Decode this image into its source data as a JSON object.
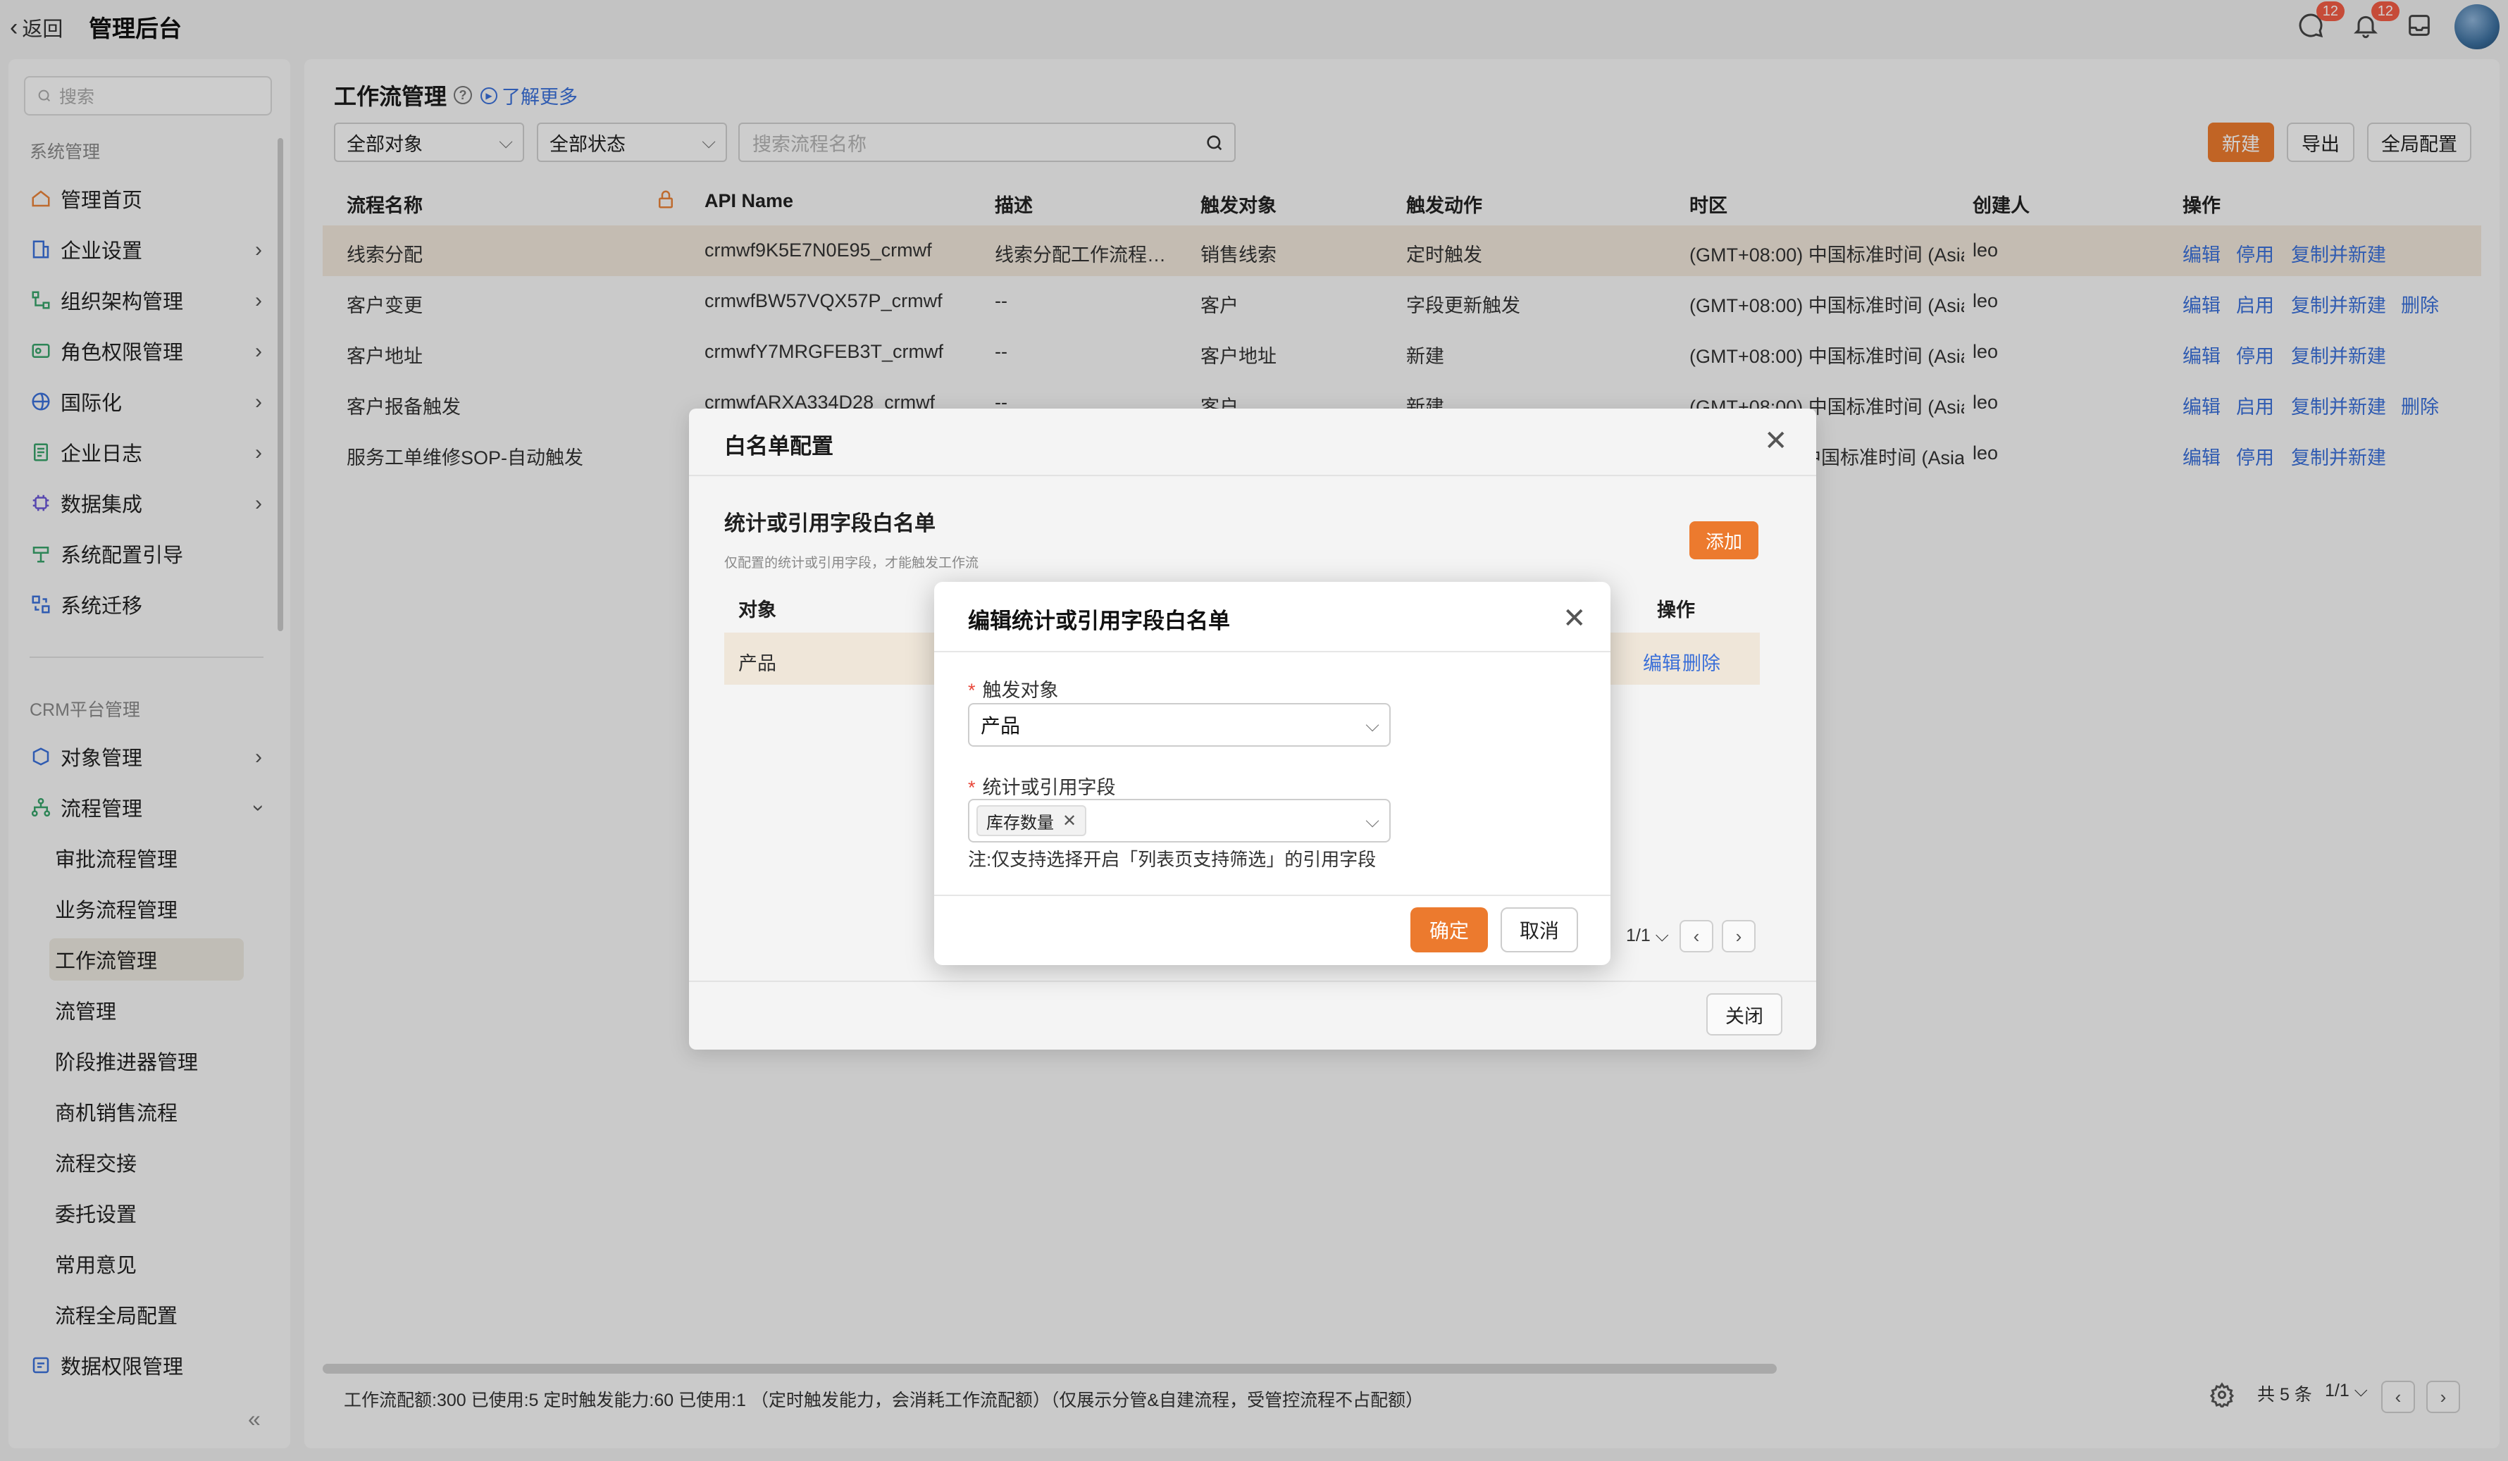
{
  "topbar": {
    "back_label": "返回",
    "app_title": "管理后台",
    "chat_badge": "12",
    "bell_badge": "12"
  },
  "sidebar": {
    "search_placeholder": "搜索",
    "section_system": "系统管理",
    "section_crm": "CRM平台管理",
    "system_items": [
      {
        "label": "管理首页",
        "icon": "home-icon"
      },
      {
        "label": "企业设置",
        "icon": "building-icon"
      },
      {
        "label": "组织架构管理",
        "icon": "org-chart-icon"
      },
      {
        "label": "角色权限管理",
        "icon": "role-icon"
      },
      {
        "label": "国际化",
        "icon": "globe-icon"
      },
      {
        "label": "企业日志",
        "icon": "log-icon"
      },
      {
        "label": "数据集成",
        "icon": "chip-icon"
      },
      {
        "label": "系统配置引导",
        "icon": "guide-icon"
      },
      {
        "label": "系统迁移",
        "icon": "migrate-icon"
      }
    ],
    "crm_items": [
      {
        "label": "对象管理",
        "icon": "object-icon"
      },
      {
        "label": "流程管理",
        "icon": "flow-icon"
      }
    ],
    "flow_sub_items": [
      "审批流程管理",
      "业务流程管理",
      "工作流管理",
      "流管理",
      "阶段推进器管理",
      "商机销售流程",
      "流程交接",
      "委托设置",
      "常用意见",
      "流程全局配置"
    ],
    "data_perm": "数据权限管理"
  },
  "main": {
    "title": "工作流管理",
    "learn_more": "了解更多",
    "filter_object": "全部对象",
    "filter_status": "全部状态",
    "search_placeholder": "搜索流程名称",
    "btn_new": "新建",
    "btn_export": "导出",
    "btn_global": "全局配置",
    "columns": [
      "流程名称",
      "API Name",
      "描述",
      "触发对象",
      "触发动作",
      "时区",
      "创建人",
      "操作"
    ],
    "rows": [
      {
        "name": "线索分配",
        "api": "crmwf9K5E7N0E95_crmwf",
        "desc": "线索分配工作流程…",
        "obj": "销售线索",
        "action": "定时触发",
        "tz": "(GMT+08:00) 中国标准时间 (Asia",
        "creator": "leo",
        "ops": [
          "编辑",
          "停用",
          "复制并新建"
        ]
      },
      {
        "name": "客户变更",
        "api": "crmwfBW57VQX57P_crmwf",
        "desc": "--",
        "obj": "客户",
        "action": "字段更新触发",
        "tz": "(GMT+08:00) 中国标准时间 (Asia",
        "creator": "leo",
        "ops": [
          "编辑",
          "启用",
          "复制并新建",
          "删除"
        ]
      },
      {
        "name": "客户地址",
        "api": "crmwfY7MRGFEB3T_crmwf",
        "desc": "--",
        "obj": "客户地址",
        "action": "新建",
        "tz": "(GMT+08:00) 中国标准时间 (Asia",
        "creator": "leo",
        "ops": [
          "编辑",
          "停用",
          "复制并新建"
        ]
      },
      {
        "name": "客户报备触发",
        "api": "crmwfARXA334D28_crmwf",
        "desc": "--",
        "obj": "客户",
        "action": "新建",
        "tz": "(GMT+08:00) 中国标准时间 (Asia",
        "creator": "leo",
        "ops": [
          "编辑",
          "启用",
          "复制并新建",
          "删除"
        ]
      },
      {
        "name": "服务工单维修SOP-自动触发",
        "api": "",
        "desc": "",
        "obj": "",
        "action": "",
        "tz": "中国标准时间 (Asia",
        "creator": "leo",
        "ops": [
          "编辑",
          "停用",
          "复制并新建"
        ]
      }
    ],
    "footer_text": "工作流配额:300  已使用:5  定时触发能力:60  已使用:1 （定时触发能力，会消耗工作流配额）（仅展示分管&自建流程，受管控流程不占配额）",
    "total": "共 5 条",
    "page": "1/1"
  },
  "whitelist_dialog": {
    "title": "白名单配置",
    "subtitle": "统计或引用字段白名单",
    "note": "仅配置的统计或引用字段，才能触发工作流",
    "add": "添加",
    "col_object": "对象",
    "col_ops": "操作",
    "row_object": "产品",
    "row_edit": "编辑",
    "row_delete": "删除",
    "page": "1/1",
    "close": "关闭"
  },
  "edit_dialog": {
    "title": "编辑统计或引用字段白名单",
    "field1_label": "触发对象",
    "field1_value": "产品",
    "field2_label": "统计或引用字段",
    "field2_tag": "库存数量",
    "note": "注:仅支持选择开启「列表页支持筛选」的引用字段",
    "ok": "确定",
    "cancel": "取消"
  }
}
